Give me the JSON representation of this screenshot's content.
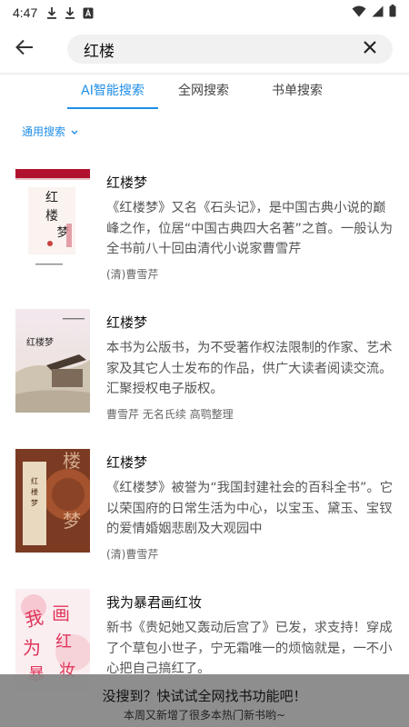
{
  "status_bar": {
    "time": "4:47",
    "icons": [
      "download-icon",
      "download-icon",
      "a-box-icon",
      "wifi-icon",
      "signal-icon",
      "battery-icon"
    ]
  },
  "search": {
    "query": "红楼",
    "back_icon": "arrow-left-icon",
    "clear_icon": "close-icon"
  },
  "tabs": [
    {
      "label": "AI智能搜索",
      "active": true
    },
    {
      "label": "全网搜索",
      "active": false
    },
    {
      "label": "书单搜索",
      "active": false
    }
  ],
  "filter": {
    "label": "通用搜索",
    "icon": "chevron-down-icon"
  },
  "books": [
    {
      "title": "红楼梦",
      "description": "《红楼梦》又名《石头记》，是中国古典小说的巅峰之作，位居“中国古典四大名著”之首。一般认为全书前八十回由清代小说家曹雪芹",
      "author": "(清)曹雪芹",
      "cover_text": "红楼梦"
    },
    {
      "title": "红楼梦",
      "description": "本书为公版书，为不受著作权法限制的作家、艺术家及其它人士发布的作品，供广大读者阅读交流。汇聚授权电子版权。",
      "author": "曹雪芹 无名氏续 高鹗整理",
      "cover_text": "红楼梦"
    },
    {
      "title": "红楼梦",
      "description": "《红楼梦》被誉为“我国封建社会的百科全书”。它以荣国府的日常生活为中心，以宝玉、黛玉、宝钗的爱情婚姻悲剧及大观园中",
      "author": "(清)曹雪芹",
      "cover_text": "红楼梦"
    },
    {
      "title": "我为暴君画红妆",
      "description": "新书《贵妃她又轰动后宫了》已发，求支持！穿成了个草包小世子，宁无霜唯一的烦恼就是，一不小心把自己搞红了。",
      "author": "",
      "cover_text": "我为暴君画红妆"
    }
  ],
  "banner": {
    "main": "没搜到？快试试全网找书功能吧！",
    "sub": "本周又新增了很多本热门新书哟~"
  },
  "colors": {
    "accent": "#1f8ee8",
    "banner_bg": "#828282"
  }
}
